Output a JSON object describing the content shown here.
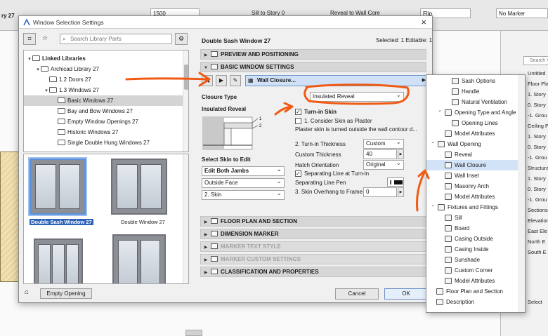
{
  "app": {
    "toolbar": {
      "thickness_value": "1500",
      "sill_label": "Sill to Story 0",
      "reveal_label": "Reveal to Wall Core",
      "flip_label": "Flip",
      "marker_value": "No Marker"
    },
    "story_label": "ry 27",
    "right_panel": {
      "search_placeholder": "Search View Ma",
      "items": [
        "Untitled",
        "Floor Pla",
        "1. Story",
        "0. Story",
        "-1. Grou",
        "Ceiling Pla",
        "1. Story",
        "0. Story",
        "-1. Grou",
        "Structural",
        "1. Story",
        "0. Story",
        "-1. Grou",
        "Sections",
        "Elevations",
        "East Ele",
        "North E",
        "South E"
      ],
      "bottom_label": "Select"
    }
  },
  "dialog": {
    "title": "Window Selection Settings",
    "library": {
      "search_placeholder": "Search Library Parts",
      "tree": [
        {
          "label": "Linked Libraries",
          "level": 0,
          "caret": "▾",
          "bold": true
        },
        {
          "label": "Archicad Library 27",
          "level": 1,
          "caret": "▾"
        },
        {
          "label": "1.2 Doors 27",
          "level": 2,
          "caret": ""
        },
        {
          "label": "1.3 Windows 27",
          "level": 2,
          "caret": "▾"
        },
        {
          "label": "Basic Windows 27",
          "level": 3,
          "caret": "",
          "selected": true
        },
        {
          "label": "Bay and Bow Windows 27",
          "level": 3,
          "caret": ""
        },
        {
          "label": "Empty Window Openings 27",
          "level": 3,
          "caret": ""
        },
        {
          "label": "Historic Windows 27",
          "level": 3,
          "caret": ""
        },
        {
          "label": "Single Double Hung Windows 27",
          "level": 3,
          "caret": ""
        }
      ],
      "thumbnails": [
        {
          "label": "Double Sash Window 27",
          "selected": true
        },
        {
          "label": "Double Window 27",
          "selected": false
        },
        {
          "label": "",
          "selected": false
        },
        {
          "label": "",
          "selected": false
        }
      ],
      "empty_opening_label": "Empty Opening"
    },
    "settings": {
      "part_name": "Double Sash Window 27",
      "selection_info": "Selected: 1 Editable: 1",
      "sections_top": [
        "PREVIEW AND POSITIONING",
        "BASIC WINDOW SETTINGS"
      ],
      "wall_closure_label": "Wall Closure...",
      "closure_type_label": "Closure Type",
      "closure_type_value": "Insulated Reveal",
      "insulated_reveal_label": "Insulated Reveal",
      "diagram_label_1": "1",
      "diagram_label_2": "2",
      "turn_in_skin_label": "Turn-in Skin",
      "consider_skin_label": "1. Consider Skin as Plaster",
      "plaster_note": "Plaster skin is turned outside the wall contour d...",
      "select_skin_label": "Select Skin to Edit",
      "skin_jambs_value": "Edit Both Jambs",
      "skin_face_value": "Outside Face",
      "skin_number_value": "2. Skin",
      "turn_in_thickness_label": "2. Turn-in Thickness",
      "turn_in_thickness_value": "Custom",
      "custom_thickness_label": "Custom Thickness",
      "custom_thickness_value": "40",
      "hatch_orientation_label": "Hatch Orientation",
      "hatch_orientation_value": "Original",
      "separating_line_label": "Separating Line at Turn-in",
      "separating_pen_label": "Separating Line Pen",
      "overhang_label": "3. Skin Overhang to Frame ...",
      "overhang_value": "0",
      "sections_bottom": [
        {
          "label": "FLOOR PLAN AND SECTION",
          "disabled": false
        },
        {
          "label": "DIMENSION MARKER",
          "disabled": false
        },
        {
          "label": "MARKER TEXT STYLE",
          "disabled": true
        },
        {
          "label": "MARKER CUSTOM SETTINGS",
          "disabled": true
        },
        {
          "label": "CLASSIFICATION AND PROPERTIES",
          "disabled": false
        }
      ],
      "cancel_label": "Cancel",
      "ok_label": "OK"
    }
  },
  "menu": {
    "items": [
      {
        "label": "Sash Options",
        "indent": 2,
        "caret": ""
      },
      {
        "label": "Handle",
        "indent": 2,
        "caret": ""
      },
      {
        "label": "Natural Ventilation",
        "indent": 2,
        "caret": ""
      },
      {
        "label": "Opening Type and Angle",
        "indent": 1,
        "caret": "⌄"
      },
      {
        "label": "Opening Lines",
        "indent": 2,
        "caret": ""
      },
      {
        "label": "Model Attributes",
        "indent": 1,
        "caret": ""
      },
      {
        "label": "Wall Opening",
        "indent": 0,
        "caret": "⌄"
      },
      {
        "label": "Reveal",
        "indent": 1,
        "caret": ""
      },
      {
        "label": "Wall Closure",
        "indent": 1,
        "caret": "",
        "highlight": true
      },
      {
        "label": "Wall Inset",
        "indent": 1,
        "caret": ""
      },
      {
        "label": "Masonry Arch",
        "indent": 1,
        "caret": ""
      },
      {
        "label": "Model Attributes",
        "indent": 1,
        "caret": ""
      },
      {
        "label": "Fixtures and Fittings",
        "indent": 0,
        "caret": "⌄"
      },
      {
        "label": "Sill",
        "indent": 1,
        "caret": ""
      },
      {
        "label": "Board",
        "indent": 1,
        "caret": ""
      },
      {
        "label": "Casing Outside",
        "indent": 1,
        "caret": ""
      },
      {
        "label": "Casing Inside",
        "indent": 1,
        "caret": ""
      },
      {
        "label": "Sunshade",
        "indent": 1,
        "caret": ""
      },
      {
        "label": "Custom Corner",
        "indent": 1,
        "caret": ""
      },
      {
        "label": "Model Attributes",
        "indent": 1,
        "caret": ""
      },
      {
        "label": "Floor Plan and Section",
        "indent": -1,
        "caret": ""
      },
      {
        "label": "Description",
        "indent": -1,
        "caret": ""
      }
    ]
  },
  "colors": {
    "annotation": "#f05a14",
    "selection_blue": "#2d62b9",
    "highlight": "#d3e3f7"
  }
}
